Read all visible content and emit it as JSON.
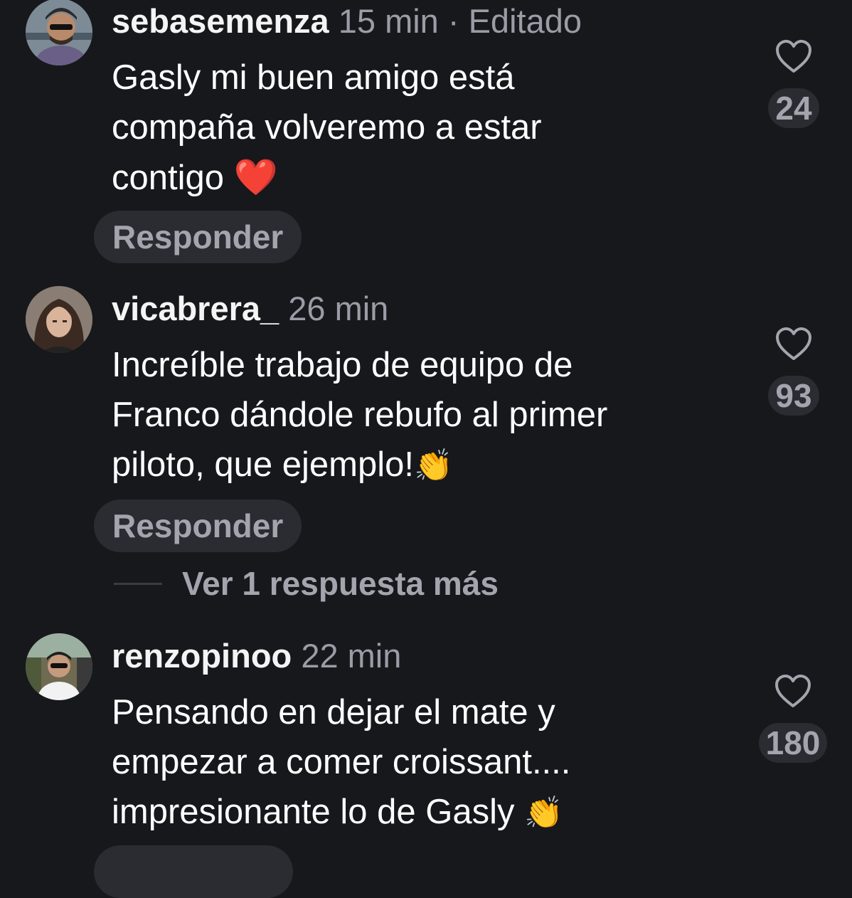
{
  "comments": [
    {
      "username": "sebasemenza",
      "meta": "15 min · Editado",
      "lines": [
        "Gasly mi buen amigo está",
        "compaña volveremo a estar",
        "contigo"
      ],
      "emoji": "❤️",
      "emoji_name": "red-heart-emoji",
      "reply_label": "Responder",
      "like_count": "24",
      "avatar_icon": "avatar-man-sunglasses-cap"
    },
    {
      "username": "vicabrera_",
      "meta": "26 min",
      "lines": [
        "Increíble trabajo de equipo de",
        "Franco dándole rebufo al primer",
        "piloto, que ejemplo!"
      ],
      "emoji": "👏",
      "emoji_name": "clapping-hands-emoji",
      "reply_label": "Responder",
      "like_count": "93",
      "avatar_icon": "avatar-woman-long-hair"
    },
    {
      "username": "renzopinoo",
      "meta": "22 min",
      "lines": [
        "Pensando en dejar el mate y",
        "empezar a comer croissant....",
        "impresionante lo de Gasly"
      ],
      "emoji": "👏",
      "emoji_name": "clapping-hands-emoji",
      "like_count": "180",
      "avatar_icon": "avatar-man-in-car"
    }
  ],
  "more_replies": {
    "label": "Ver 1 respuesta más"
  },
  "colors": {
    "background": "#17181c",
    "muted_text": "#9a9ca6",
    "pill_bg": "#2a2c31",
    "heart_emoji": "#e0202a",
    "clap_emoji": "#f2bd2a"
  },
  "icons": {
    "like": "heart-outline-icon"
  }
}
